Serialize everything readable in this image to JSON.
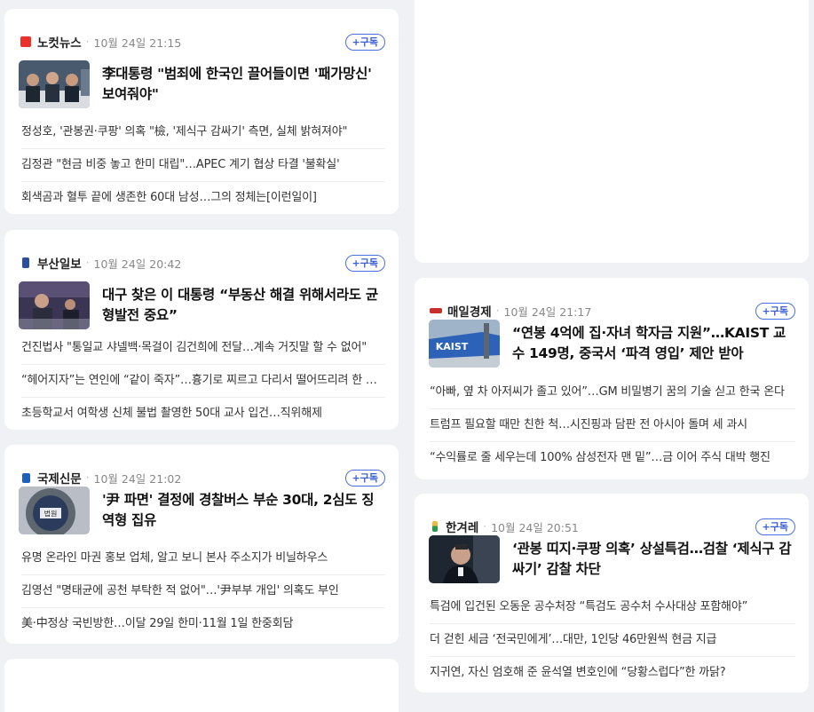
{
  "subscribe_label": "+구독",
  "cards": [
    {
      "press": "노컷뉴스",
      "time": "10월 24일 21:15",
      "logo_color": "#e8322b",
      "headline": "李대통령 \"범죄에 한국인 끌어들이면 '패가망신' 보여줘야\"",
      "items": [
        "정성호, '관봉권·쿠팡' 의혹 \"檢, '제식구 감싸기' 측면, 실체 밝혀져야\"",
        "김정관 \"현금 비중 놓고 한미 대립\"…APEC 계기 협상 타결 '불확실'",
        "회색곰과 혈투 끝에 생존한 60대 남성…그의 정체는[이런일이]"
      ]
    },
    {
      "press": "부산일보",
      "time": "10월 24일 20:42",
      "logo_color": "#2a4f9e",
      "headline": "대구 찾은 이 대통령 “부동산 해결 위해서라도 균형발전 중요”",
      "items": [
        "건진법사 \"통일교 샤넬백·목걸이 김건희에 전달…계속 거짓말 할 수 없어\"",
        "“헤어지자”는 연인에 “같이 죽자”…흉기로 찌르고 다리서 떨어뜨리려 한 남성",
        "초등학교서 여학생 신체 불법 촬영한 50대 교사 입건…직위해제"
      ]
    },
    {
      "press": "국제신문",
      "time": "10월 24일 21:02",
      "logo_color": "#1f5fbf",
      "headline": "'尹 파면' 결정에 경찰버스 부순 30대, 2심도 징역형 집유",
      "thumb_text": "법원",
      "items": [
        "유명 온라인 마권 홍보 업체, 알고 보니 본사 주소지가 비닐하우스",
        "김영선 \"명태균에 공천 부탁한 적 없어\"…'尹부부 개입' 의혹도 부인",
        "美·中정상 국빈방한…이달 29일 한미·11월 1일 한중회담"
      ]
    },
    {
      "press": "매일경제",
      "time": "10월 24일 21:17",
      "logo_color": "#c9302c",
      "headline": "“연봉 4억에 집·자녀 학자금 지원”…KAIST 교수 149명, 중국서 ‘파격 영입’ 제안 받아",
      "thumb_text": "KAIST",
      "items": [
        "“아빠, 옆 차 아저씨가 졸고 있어”…GM 비밀병기 꿈의 기술 싣고 한국 온다",
        "트럼프 필요할 때만 친한 척…시진핑과 담판 전 아시아 돌며 세 과시",
        "“수익률로 줄 세우는데 100% 삼성전자 맨 밑”…금 이어 주식 대박 행진"
      ]
    },
    {
      "press": "한겨레",
      "time": "10월 24일 20:51",
      "logo_color": "#2b9a4a",
      "headline": "‘관봉 띠지·쿠팡 의혹’ 상설특검…검찰 ‘제식구 감싸기’ 감찰 차단",
      "items": [
        "특검에 입건된 오동운 공수처장 “특검도 공수처 수사대상 포함해야”",
        "더 걷힌 세금 ‘전국민에게’…대만, 1인당 46만원씩 현금 지급",
        "지귀연, 자신 엄호해 준 윤석열 변호인에 “당황스럽다”한 까닭?"
      ]
    }
  ]
}
